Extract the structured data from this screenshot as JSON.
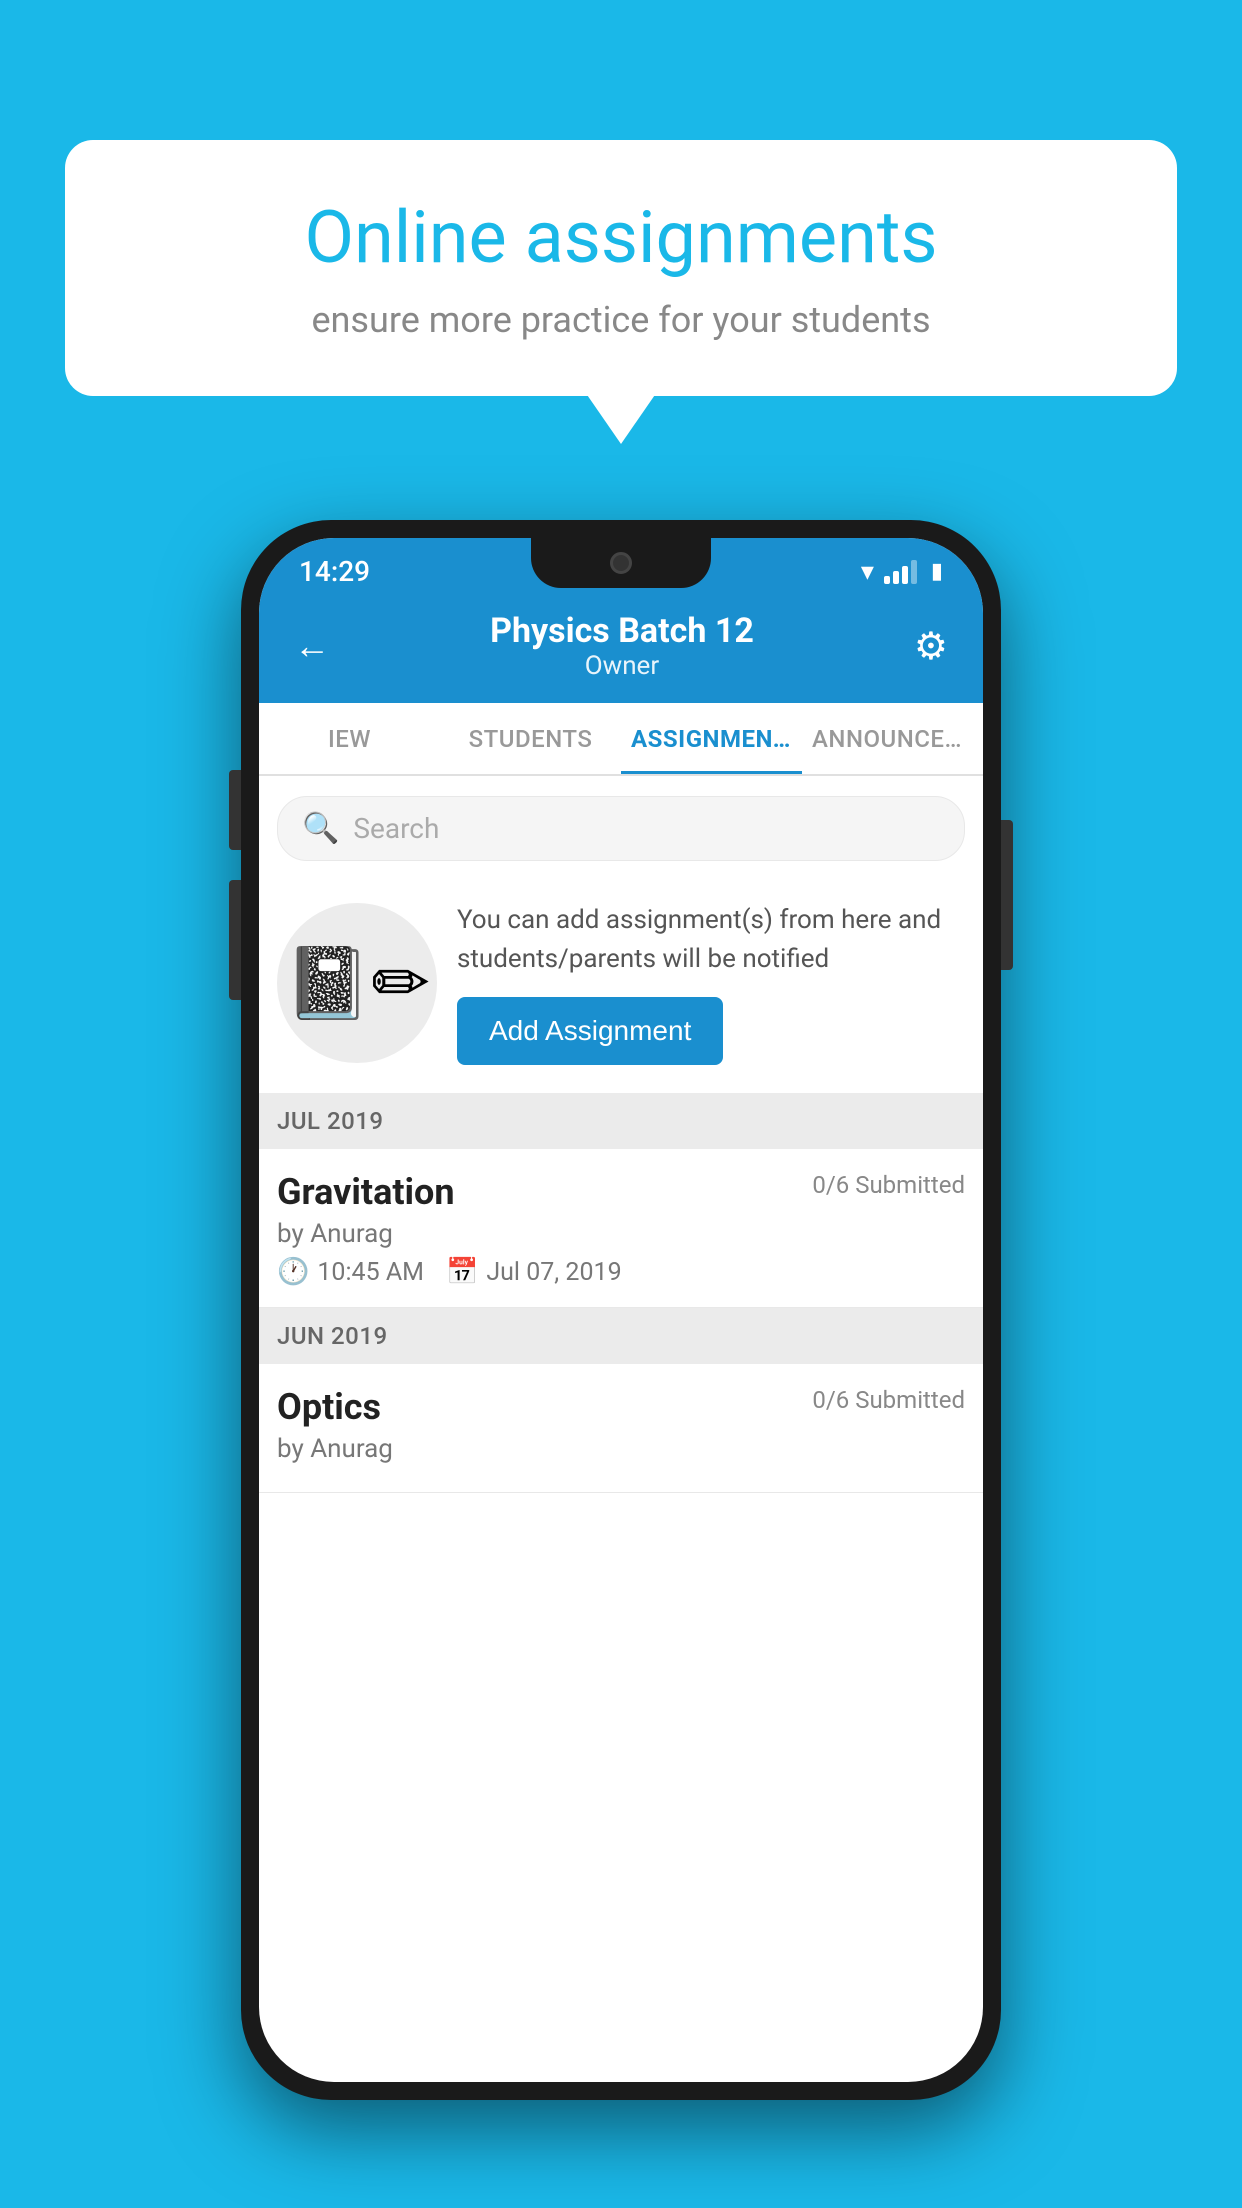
{
  "background_color": "#1ab8e8",
  "speech_bubble": {
    "title": "Online assignments",
    "subtitle": "ensure more practice for your students"
  },
  "phone": {
    "status_bar": {
      "time": "14:29"
    },
    "header": {
      "title": "Physics Batch 12",
      "subtitle": "Owner",
      "back_label": "←",
      "gear_label": "⚙"
    },
    "tabs": [
      {
        "label": "IEW",
        "active": false
      },
      {
        "label": "STUDENTS",
        "active": false
      },
      {
        "label": "ASSIGNMENTS",
        "active": true
      },
      {
        "label": "ANNOUNCEMENTS",
        "active": false
      }
    ],
    "search": {
      "placeholder": "Search"
    },
    "promo": {
      "text": "You can add assignment(s) from here and students/parents will be notified",
      "button_label": "Add Assignment"
    },
    "sections": [
      {
        "label": "JUL 2019",
        "assignments": [
          {
            "name": "Gravitation",
            "submitted": "0/6 Submitted",
            "by": "by Anurag",
            "time": "10:45 AM",
            "date": "Jul 07, 2019"
          }
        ]
      },
      {
        "label": "JUN 2019",
        "assignments": [
          {
            "name": "Optics",
            "submitted": "0/6 Submitted",
            "by": "by Anurag",
            "time": "",
            "date": ""
          }
        ]
      }
    ]
  }
}
